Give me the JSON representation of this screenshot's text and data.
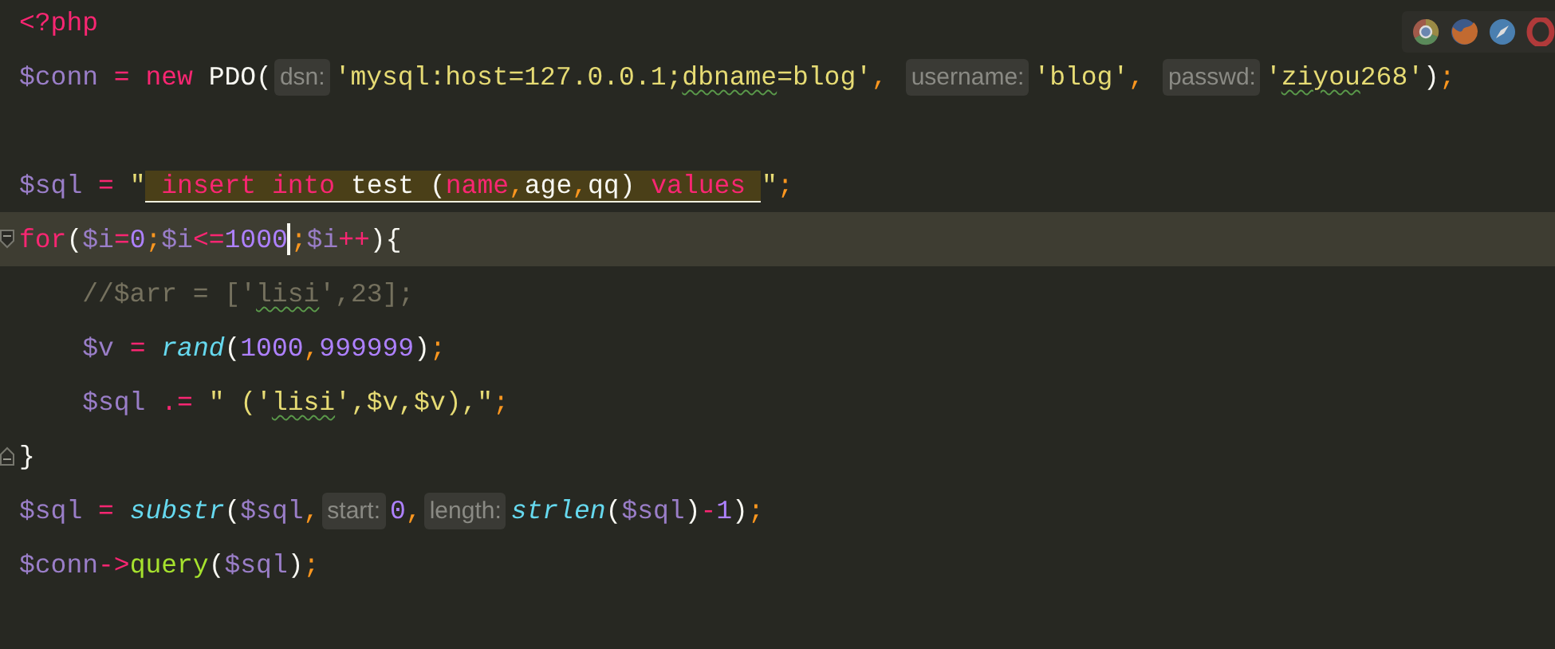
{
  "lines": [
    {
      "tokens": [
        {
          "kind": "tag",
          "text": "<?php"
        }
      ]
    },
    {
      "tokens": [
        {
          "kind": "var",
          "text": "$conn"
        },
        {
          "kind": "op",
          "text": " = "
        },
        {
          "kind": "kw",
          "text": "new"
        },
        {
          "kind": "plain",
          "text": " PDO("
        },
        {
          "kind": "hint",
          "text": "dsn:"
        },
        {
          "kind": "str",
          "text": "'mysql:host=127.0.0.1;"
        },
        {
          "kind": "str",
          "text": "dbname",
          "typo": true
        },
        {
          "kind": "str",
          "text": "=blog'"
        },
        {
          "kind": "punct",
          "text": ", "
        },
        {
          "kind": "hint",
          "text": "username:"
        },
        {
          "kind": "str",
          "text": "'blog'"
        },
        {
          "kind": "punct",
          "text": ", "
        },
        {
          "kind": "hint",
          "text": "passwd:"
        },
        {
          "kind": "str",
          "text": "'"
        },
        {
          "kind": "str",
          "text": "ziyou",
          "typo": true
        },
        {
          "kind": "str",
          "text": "268'"
        },
        {
          "kind": "plain",
          "text": ")"
        },
        {
          "kind": "punct",
          "text": ";"
        }
      ]
    },
    {
      "kind": "blank"
    },
    {
      "tokens": [
        {
          "kind": "var",
          "text": "$sql"
        },
        {
          "kind": "op",
          "text": " = "
        },
        {
          "kind": "str",
          "text": "\""
        },
        {
          "kind": "sqlkw",
          "text": " insert into ",
          "highlight": true
        },
        {
          "kind": "plain",
          "text": "test (",
          "highlight": true
        },
        {
          "kind": "sqlkw",
          "text": "name",
          "highlight": true
        },
        {
          "kind": "punct",
          "text": ",",
          "highlight": true
        },
        {
          "kind": "plain",
          "text": "age",
          "highlight": true
        },
        {
          "kind": "punct",
          "text": ",",
          "highlight": true
        },
        {
          "kind": "plain",
          "text": "qq) ",
          "highlight": true
        },
        {
          "kind": "sqlkw",
          "text": "values ",
          "highlight": true
        },
        {
          "kind": "str",
          "text": "\""
        },
        {
          "kind": "punct",
          "text": ";"
        }
      ]
    },
    {
      "current": true,
      "fold_start": true,
      "tokens": [
        {
          "kind": "kw",
          "text": "for"
        },
        {
          "kind": "plain",
          "text": "("
        },
        {
          "kind": "var",
          "text": "$i"
        },
        {
          "kind": "op",
          "text": "="
        },
        {
          "kind": "num",
          "text": "0"
        },
        {
          "kind": "punct",
          "text": ";"
        },
        {
          "kind": "var",
          "text": "$i"
        },
        {
          "kind": "op",
          "text": "<="
        },
        {
          "kind": "num",
          "text": "1000"
        },
        {
          "kind": "cursor"
        },
        {
          "kind": "punct",
          "text": ";"
        },
        {
          "kind": "var",
          "text": "$i"
        },
        {
          "kind": "op",
          "text": "++"
        },
        {
          "kind": "plain",
          "text": "){"
        }
      ]
    },
    {
      "tokens": [
        {
          "kind": "comment",
          "text": "    //$arr = ['"
        },
        {
          "kind": "comment",
          "text": "lisi",
          "typo": true
        },
        {
          "kind": "comment",
          "text": "',23];"
        }
      ]
    },
    {
      "tokens": [
        {
          "kind": "var",
          "text": "    $v"
        },
        {
          "kind": "op",
          "text": " = "
        },
        {
          "kind": "func",
          "text": "rand"
        },
        {
          "kind": "plain",
          "text": "("
        },
        {
          "kind": "num",
          "text": "1000"
        },
        {
          "kind": "punct",
          "text": ","
        },
        {
          "kind": "num",
          "text": "999999"
        },
        {
          "kind": "plain",
          "text": ")"
        },
        {
          "kind": "punct",
          "text": ";"
        }
      ]
    },
    {
      "tokens": [
        {
          "kind": "var",
          "text": "    $sql"
        },
        {
          "kind": "op",
          "text": " .= "
        },
        {
          "kind": "str",
          "text": "\" ('"
        },
        {
          "kind": "str",
          "text": "lisi",
          "typo": true
        },
        {
          "kind": "str",
          "text": "',$v,$v),\""
        },
        {
          "kind": "punct",
          "text": ";"
        }
      ]
    },
    {
      "fold_end": true,
      "tokens": [
        {
          "kind": "plain",
          "text": "}"
        }
      ]
    },
    {
      "tokens": [
        {
          "kind": "var",
          "text": "$sql"
        },
        {
          "kind": "op",
          "text": " = "
        },
        {
          "kind": "func",
          "text": "substr"
        },
        {
          "kind": "plain",
          "text": "("
        },
        {
          "kind": "var",
          "text": "$sql"
        },
        {
          "kind": "punct",
          "text": ","
        },
        {
          "kind": "hint",
          "text": "start:"
        },
        {
          "kind": "num",
          "text": "0"
        },
        {
          "kind": "punct",
          "text": ","
        },
        {
          "kind": "hint",
          "text": "length:"
        },
        {
          "kind": "func",
          "text": "strlen"
        },
        {
          "kind": "plain",
          "text": "("
        },
        {
          "kind": "var",
          "text": "$sql"
        },
        {
          "kind": "plain",
          "text": ")"
        },
        {
          "kind": "op",
          "text": "-"
        },
        {
          "kind": "num",
          "text": "1"
        },
        {
          "kind": "plain",
          "text": ")"
        },
        {
          "kind": "punct",
          "text": ";"
        }
      ]
    },
    {
      "tokens": [
        {
          "kind": "var",
          "text": "$conn"
        },
        {
          "kind": "op",
          "text": "->"
        },
        {
          "kind": "method",
          "text": "query"
        },
        {
          "kind": "plain",
          "text": "("
        },
        {
          "kind": "var",
          "text": "$sql"
        },
        {
          "kind": "plain",
          "text": ")"
        },
        {
          "kind": "punct",
          "text": ";"
        }
      ]
    }
  ]
}
